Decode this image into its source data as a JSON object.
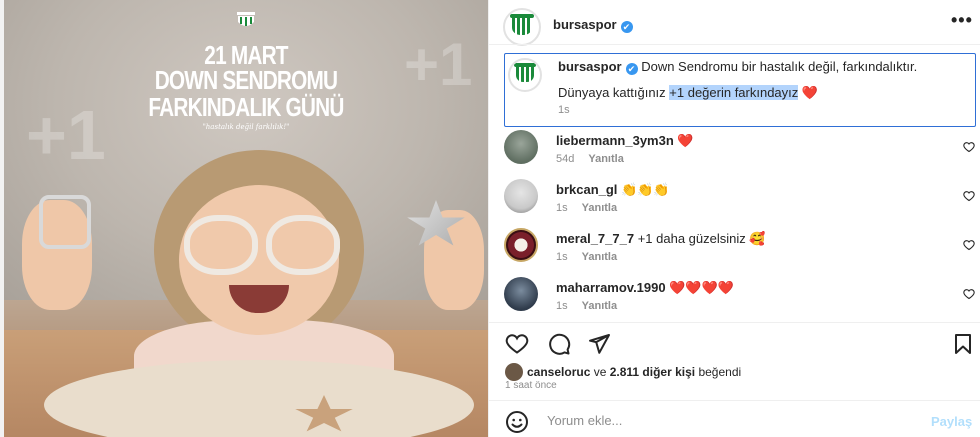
{
  "post": {
    "username": "bursaspor",
    "verified_mark": "✔",
    "more_glyph": "•••",
    "poster": {
      "line1": "21 MART",
      "line2": "DOWN SENDROMU",
      "line3": "FARKINDALIK GÜNÜ",
      "tagline": "\"hastalık değil farklılık!\""
    },
    "caption": {
      "username": "bursaspor",
      "text1": "Down Sendromu bir hastalık değil, farkındalıktır.",
      "text2_plain": "Dünyaya kattığınız ",
      "text2_highlight": "+1 değerin farkındayız",
      "text2_heart": "❤️",
      "time": "1s"
    }
  },
  "comments": [
    {
      "username": "liebermann_3ym3n",
      "text": "❤️",
      "time": "54d",
      "reply": "Yanıtla",
      "avatar_icon": "user-avatar-icon"
    },
    {
      "username": "brkcan_gl",
      "text": "👏👏👏",
      "time": "1s",
      "reply": "Yanıtla",
      "avatar_icon": "user-avatar-icon"
    },
    {
      "username": "meral_7_7_7",
      "text": "+1 daha güzelsiniz 🥰",
      "time": "1s",
      "reply": "Yanıtla",
      "avatar_icon": "user-avatar-icon"
    },
    {
      "username": "maharramov.1990",
      "text": "❤️❤️❤️❤️",
      "time": "1s",
      "reply": "Yanıtla",
      "avatar_icon": "user-avatar-icon"
    }
  ],
  "likes": {
    "first_user": "canseloruc",
    "joiner": " ve ",
    "others": "2.811 diğer kişi",
    "suffix": " beğendi"
  },
  "posted_ago": "1 saat önce",
  "add_comment": {
    "placeholder": "Yorum ekle...",
    "post_label": "Paylaş"
  },
  "colors": {
    "verified": "#3897f0",
    "highlight": "#b3d4fc",
    "selection_border": "#2f6fd6",
    "heart": "#ed4956",
    "post_button_disabled": "#b2dffc"
  }
}
